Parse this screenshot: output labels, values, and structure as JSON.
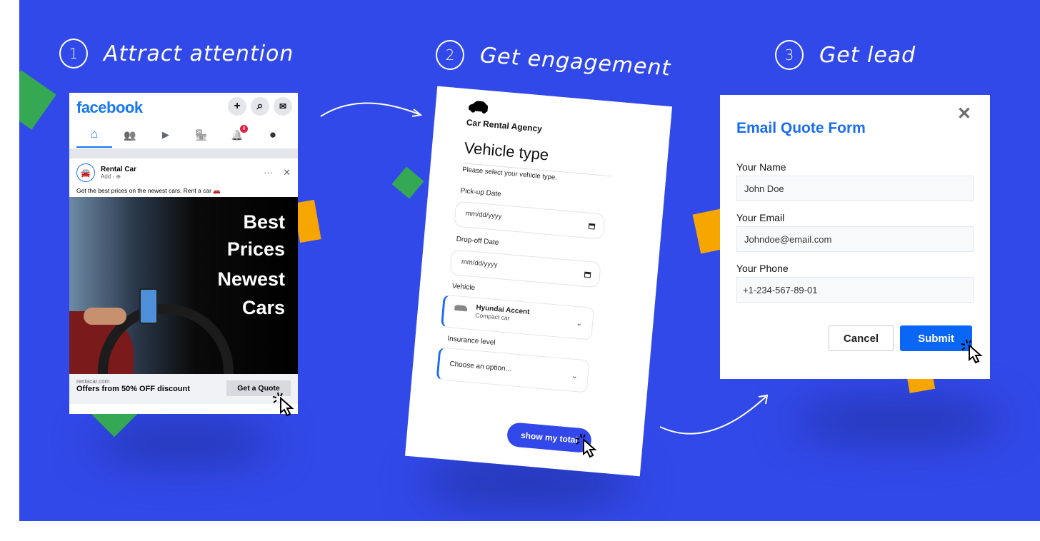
{
  "steps": [
    {
      "number": "1",
      "label": "Attract attention"
    },
    {
      "number": "2",
      "label": "Get engagement"
    },
    {
      "number": "3",
      "label": "Get lead"
    }
  ],
  "facebook": {
    "logo": "facebook",
    "actions": [
      "+",
      "⌕",
      "✉"
    ],
    "nav": [
      "⌂",
      "👥",
      "▶",
      "🏪",
      "🔔",
      "●"
    ],
    "notification_count": "8",
    "post": {
      "page_name": "Rental Car",
      "subtitle": "Add · ⊕",
      "more": "···",
      "close": "✕",
      "text": "Get the best prices on the newest cars. Rent a car 🚗",
      "ad_lines": [
        "Best",
        "Prices",
        "Newest",
        "Cars"
      ],
      "site": "rentacar.com",
      "offer": "Offers from 50% OFF discount",
      "cta": "Get a Quote"
    }
  },
  "rental_form": {
    "car_icon": "🚗",
    "agency": "Car Rental Agency",
    "title": "Vehicle type",
    "subtitle": "Please select your vehicle type.",
    "pickup_label": "Pick-up Date",
    "pickup_placeholder": "mm/dd/yyyy",
    "dropoff_label": "Drop-off Date",
    "dropoff_placeholder": "mm/dd/yyyy",
    "vehicle_label": "Vehicle",
    "vehicle_name": "Hyundai Accent",
    "vehicle_type": "Compact car",
    "insurance_label": "Insurance level",
    "insurance_placeholder": "Choose an option...",
    "chevron": "⌄",
    "submit": "show my total"
  },
  "quote_form": {
    "title": "Email Quote Form",
    "close": "✕",
    "name_label": "Your Name",
    "name_value": "John Doe",
    "email_label": "Your Email",
    "email_value": "Johndoe@email.com",
    "phone_label": "Your Phone",
    "phone_value": "+1-234-567-89-01",
    "cancel": "Cancel",
    "submit": "Submit"
  },
  "colors": {
    "background": "#3249ea",
    "facebook_blue": "#1877f2",
    "form_accent": "#0a66f5",
    "green": "#35a853",
    "orange": "#f7a600"
  }
}
